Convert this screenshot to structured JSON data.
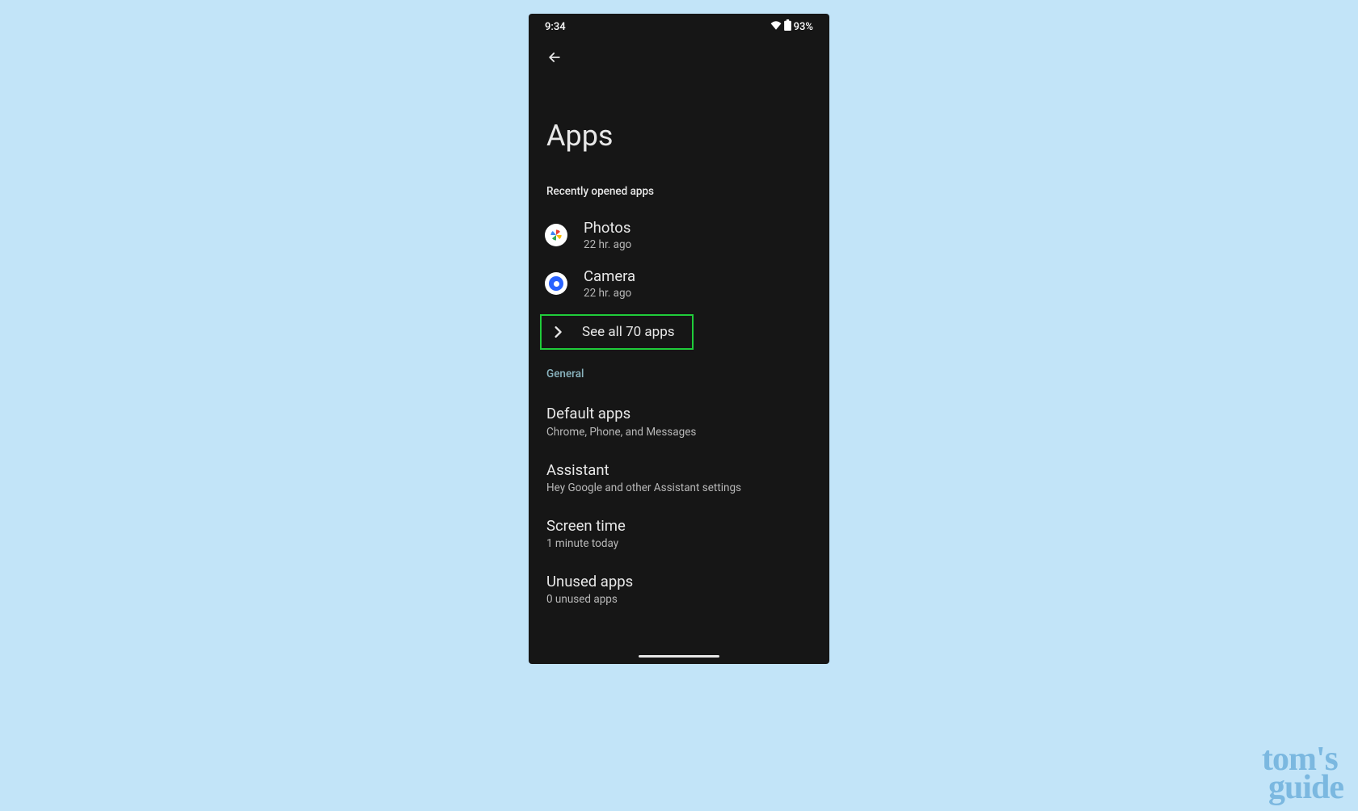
{
  "status": {
    "time": "9:34",
    "battery_pct": "93%"
  },
  "page": {
    "title": "Apps"
  },
  "recent": {
    "header": "Recently opened apps",
    "items": [
      {
        "name": "Photos",
        "sub": "22 hr. ago",
        "icon": "photos"
      },
      {
        "name": "Camera",
        "sub": "22 hr. ago",
        "icon": "camera"
      }
    ],
    "see_all": "See all 70 apps"
  },
  "general": {
    "header": "General",
    "items": [
      {
        "title": "Default apps",
        "sub": "Chrome, Phone, and Messages"
      },
      {
        "title": "Assistant",
        "sub": "Hey Google and other Assistant settings"
      },
      {
        "title": "Screen time",
        "sub": "1 minute today"
      },
      {
        "title": "Unused apps",
        "sub": "0 unused apps"
      }
    ]
  },
  "watermark": {
    "line1": "tom",
    "line2": "guide"
  },
  "highlight_color": "#1fcc3a"
}
